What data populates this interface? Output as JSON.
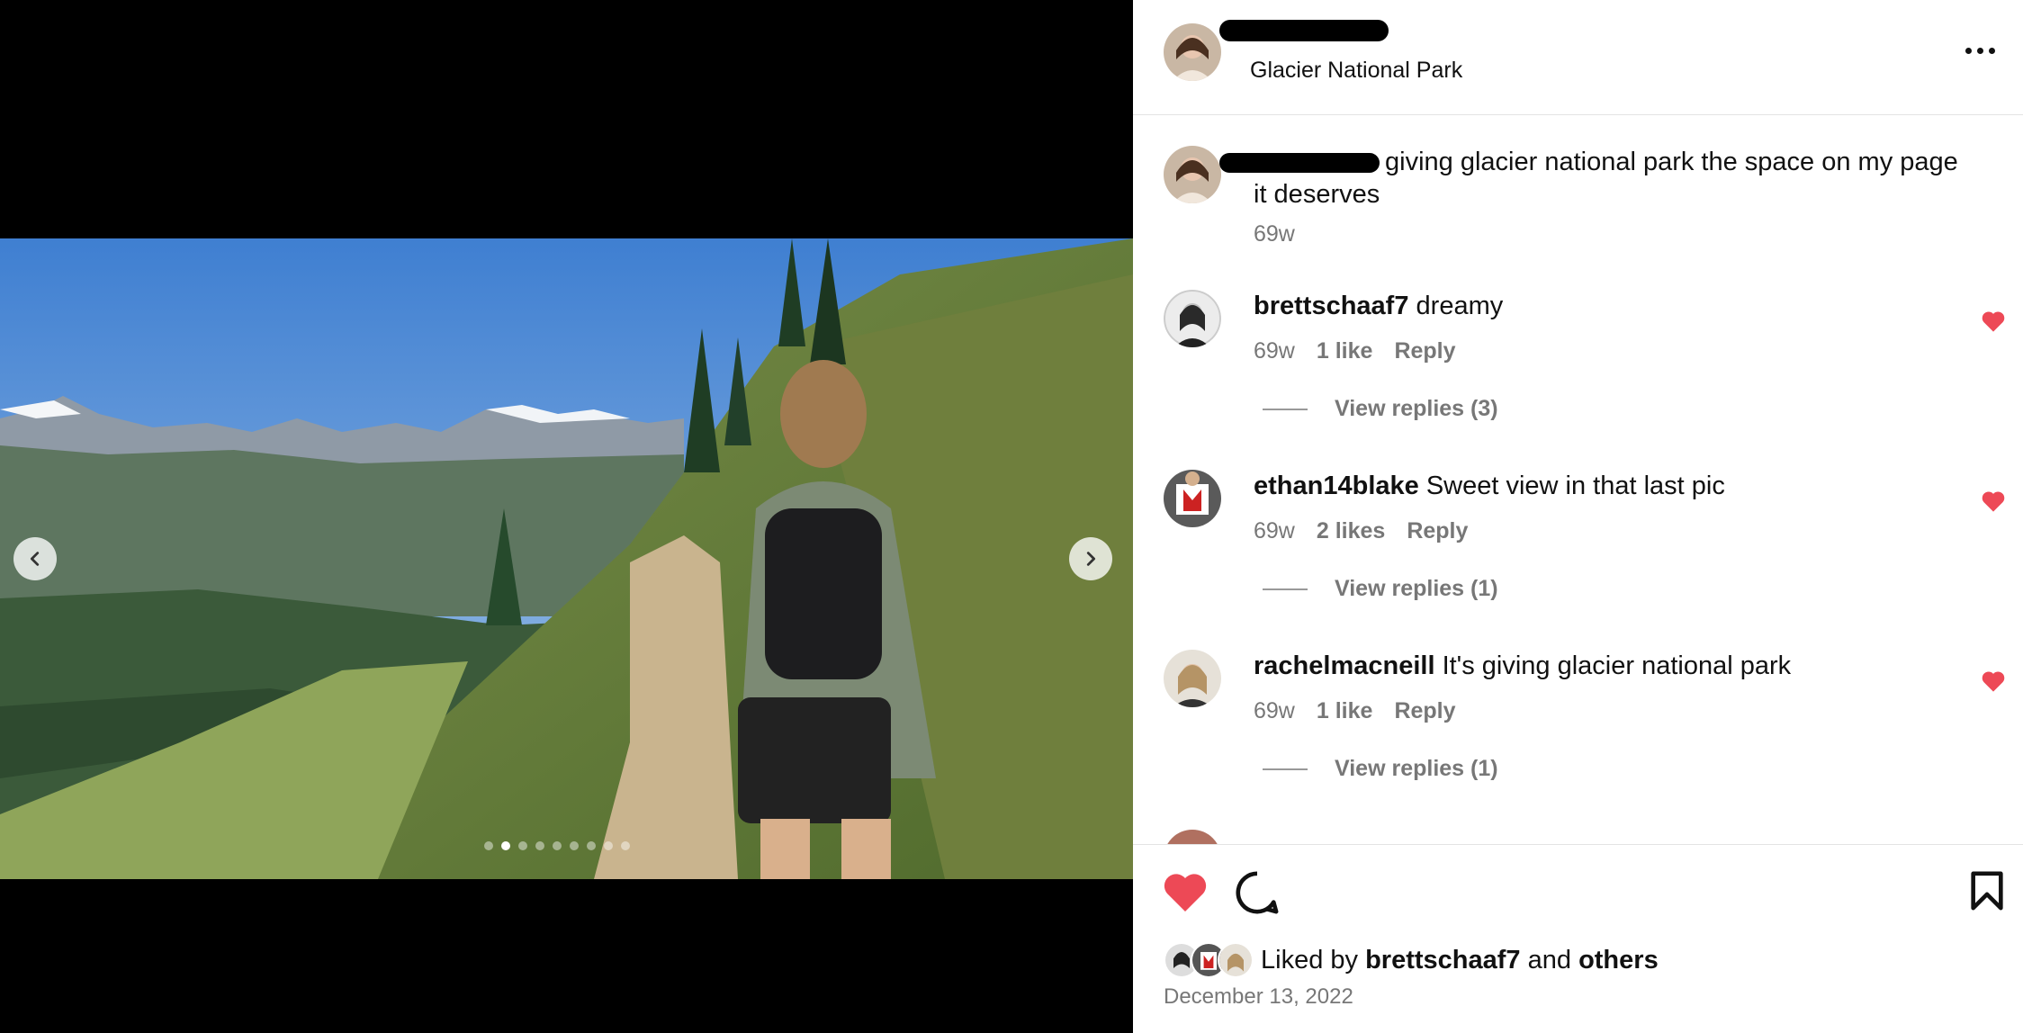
{
  "media": {
    "carousel_count": 9,
    "active_index": 1,
    "prev_label": "Previous",
    "next_label": "Next"
  },
  "header": {
    "username": "",
    "location": "Glacier National Park"
  },
  "caption": {
    "username": "",
    "text": "giving glacier national park the space on my page it deserves",
    "time": "69w"
  },
  "comments": [
    {
      "user": "brettschaaf7",
      "text": "dreamy",
      "time": "69w",
      "likes": "1 like",
      "reply": "Reply",
      "view_replies": "View replies (3)",
      "liked": true
    },
    {
      "user": "ethan14blake",
      "text": "Sweet view in that last pic",
      "time": "69w",
      "likes": "2 likes",
      "reply": "Reply",
      "view_replies": "View replies (1)",
      "liked": true
    },
    {
      "user": "rachelmacneill",
      "text": "It's giving glacier national park",
      "time": "69w",
      "likes": "1 like",
      "reply": "Reply",
      "view_replies": "View replies (1)",
      "liked": true
    }
  ],
  "footer": {
    "liked_prefix": "Liked by",
    "liked_user": "brettschaaf7",
    "liked_and": "and",
    "liked_others": "others",
    "date": "December 13, 2022"
  },
  "colors": {
    "heart": "#ed4956",
    "meta": "#777777"
  }
}
